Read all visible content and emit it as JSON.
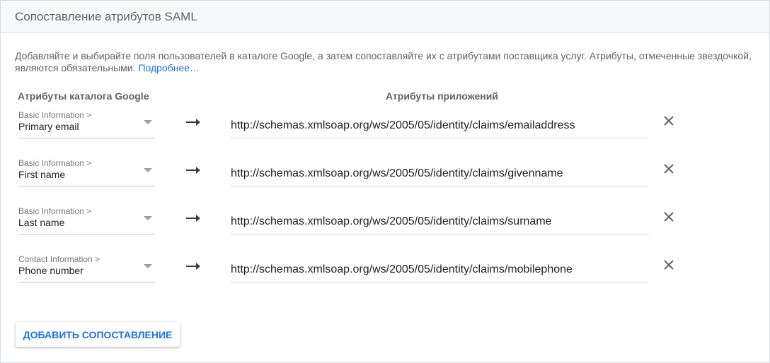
{
  "header": {
    "title": "Сопоставление атрибутов SAML"
  },
  "description": {
    "text": "Добавляйте и выбирайте поля пользователей в каталоге Google, а затем сопоставляйте их с атрибутами поставщика услуг. Атрибуты, отмеченные звездочкой, являются обязательными. ",
    "link": "Подробнее…"
  },
  "columns": {
    "google": "Атрибуты каталога Google",
    "app": "Атрибуты приложений"
  },
  "mappings": [
    {
      "category": "Basic Information >",
      "field": "Primary email",
      "attribute": "http://schemas.xmlsoap.org/ws/2005/05/identity/claims/emailaddress"
    },
    {
      "category": "Basic Information >",
      "field": "First name",
      "attribute": "http://schemas.xmlsoap.org/ws/2005/05/identity/claims/givenname"
    },
    {
      "category": "Basic Information >",
      "field": "Last name",
      "attribute": "http://schemas.xmlsoap.org/ws/2005/05/identity/claims/surname"
    },
    {
      "category": "Contact Information >",
      "field": "Phone number",
      "attribute": "http://schemas.xmlsoap.org/ws/2005/05/identity/claims/mobilephone"
    }
  ],
  "icons": {
    "arrow": "arrow-right-icon",
    "remove": "close-icon",
    "dropdown": "caret-down-icon"
  },
  "colors": {
    "link": "#1a73e8",
    "button_text": "#1a73e8",
    "header_bg": "#f8f9fa"
  },
  "actions": {
    "add_mapping": "ДОБАВИТЬ СОПОСТАВЛЕНИЕ"
  }
}
